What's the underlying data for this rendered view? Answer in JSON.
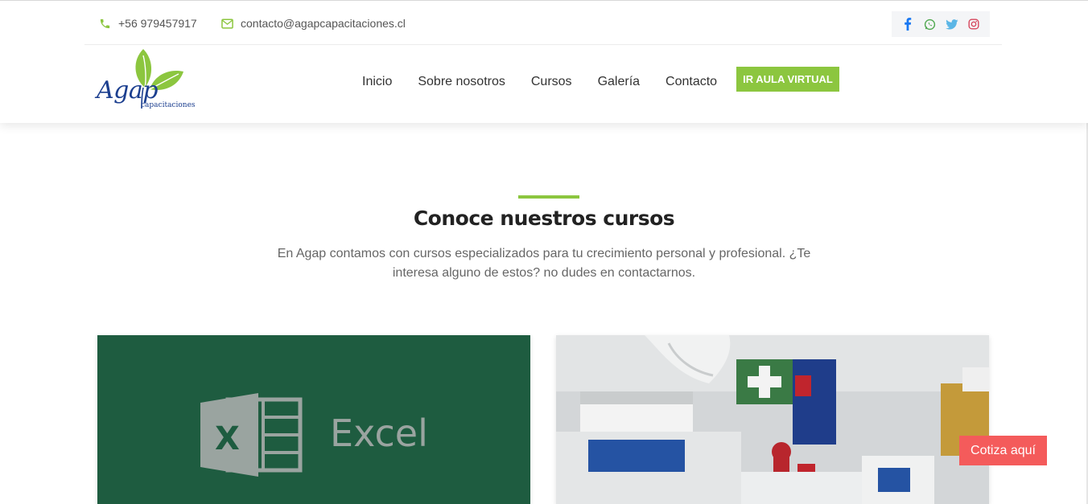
{
  "topbar": {
    "phone": "+56 979457917",
    "email": "contacto@agapcapacitaciones.cl",
    "phone_icon": "phone-icon",
    "email_icon": "envelope-icon",
    "social_icons": [
      "facebook-icon",
      "whatsapp-icon",
      "twitter-icon",
      "instagram-icon"
    ]
  },
  "brand": {
    "logo_word": "Agap",
    "logo_sub": "capacitaciones"
  },
  "nav": {
    "items": [
      "Inicio",
      "Sobre nosotros",
      "Cursos",
      "Galería",
      "Contacto"
    ],
    "cta": "IR AULA VIRTUAL"
  },
  "section": {
    "title": "Conoce nuestros cursos",
    "description": "En Agap contamos con cursos especializados para tu crecimiento personal y profesional. ¿Te interesa alguno de estos? no dudes en contactarnos."
  },
  "cards": [
    {
      "image_text": "Excel"
    },
    {
      "image_text": ""
    }
  ],
  "floating": {
    "cotiza": "Cotiza aquí"
  },
  "colors": {
    "accent_green": "#8cc63f",
    "brand_blue": "#1c3f8f",
    "excel_green": "#1e5c40",
    "cotiza_red": "#f45b5b",
    "facebook": "#1877f2",
    "whatsapp": "#4fa84f",
    "twitter": "#5bb6e6",
    "instagram": "#d6475d"
  }
}
